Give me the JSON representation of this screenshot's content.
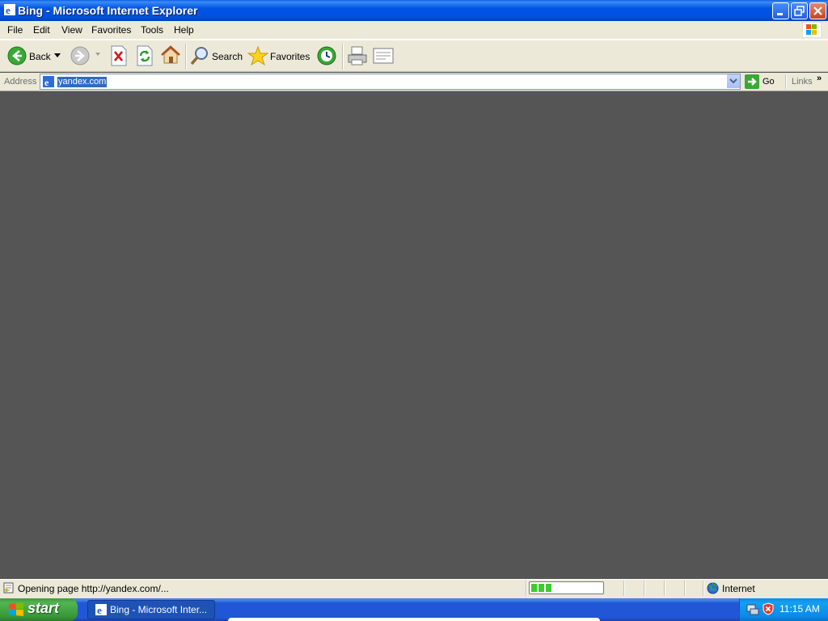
{
  "window": {
    "title": "Bing - Microsoft Internet Explorer"
  },
  "menu": {
    "items": [
      "File",
      "Edit",
      "View",
      "Favorites",
      "Tools",
      "Help"
    ]
  },
  "toolbar": {
    "back_label": "Back",
    "search_label": "Search",
    "favorites_label": "Favorites"
  },
  "address": {
    "label": "Address",
    "value": "yandex.com",
    "go_label": "Go",
    "links_label": "Links"
  },
  "status": {
    "text": "Opening page http://yandex.com/...",
    "zone": "Internet",
    "progress_fraction": 0.3
  },
  "taskbar": {
    "start_label": "start",
    "task_label": "Bing - Microsoft Inter...",
    "clock": "11:15 AM"
  },
  "colors": {
    "title_blue": "#0054E3",
    "content_bg": "#555555",
    "selection": "#316AC5",
    "taskbar_blue": "#2157D7",
    "start_green": "#389838"
  }
}
